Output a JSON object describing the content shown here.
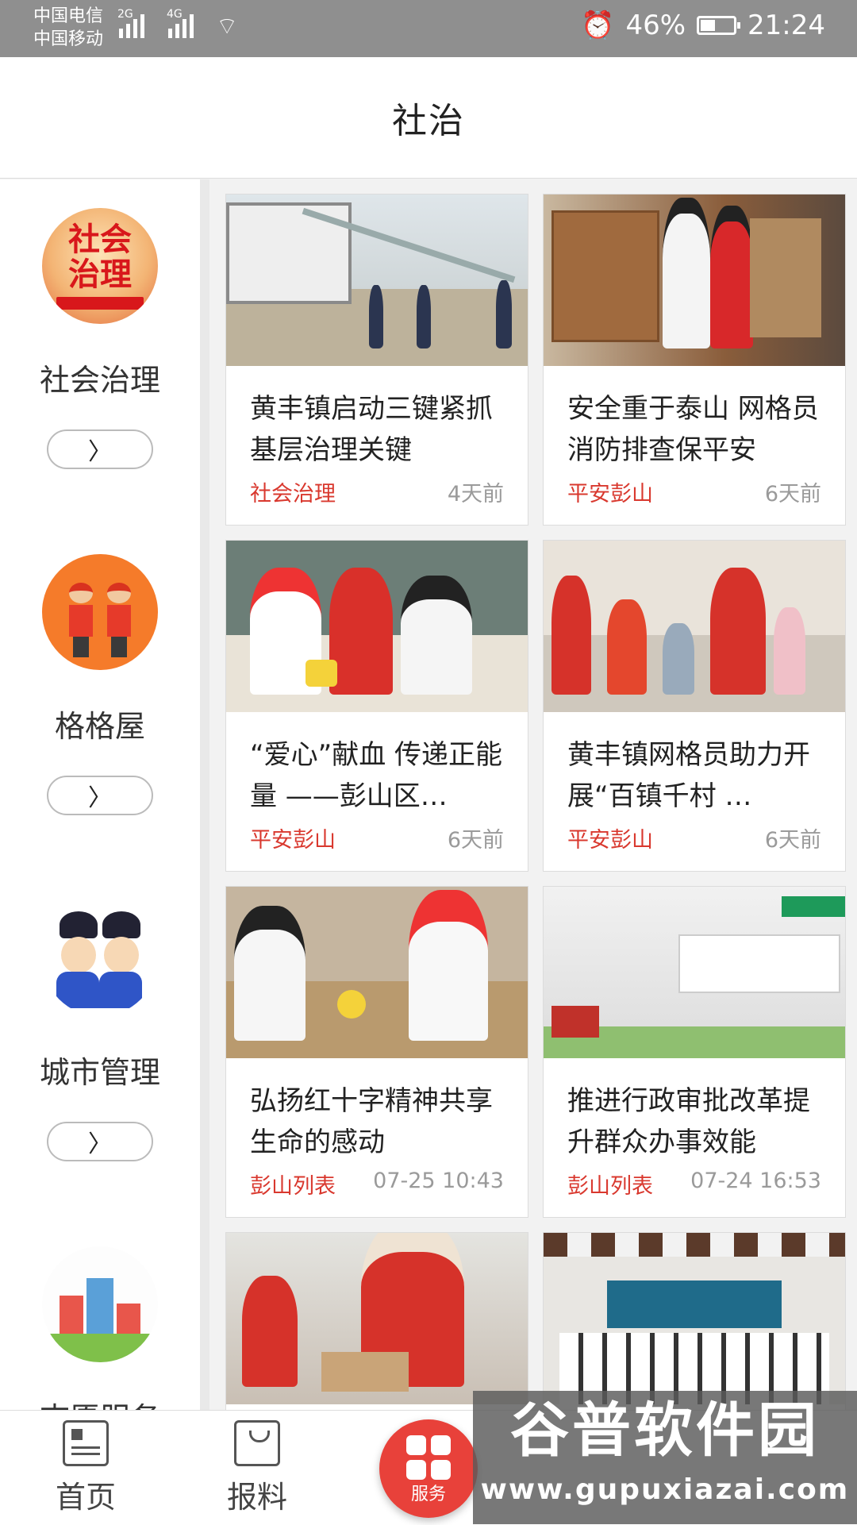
{
  "status_bar": {
    "carrier_1": "中国电信",
    "carrier_2": "中国移动",
    "net_1": "2G",
    "net_2": "4G",
    "battery": "46%",
    "battery_level": 0.46,
    "time": "21:24"
  },
  "header": {
    "title": "社治"
  },
  "sidebar": {
    "items": [
      {
        "label": "社会治理",
        "logo_text_1": "社会",
        "logo_text_2": "治理",
        "icon": "social-governance-logo"
      },
      {
        "label": "格格屋",
        "icon": "grid-workers-logo"
      },
      {
        "label": "城市管理",
        "icon": "city-management-logo"
      },
      {
        "label": "志愿服务",
        "icon": "volunteer-service-logo"
      }
    ]
  },
  "news": [
    {
      "title": "黄丰镇启动三键紧抓基层治理关键",
      "source": "社会治理",
      "time": "4天前"
    },
    {
      "title": "安全重于泰山 网格员消防排查保平安",
      "source": "平安彭山",
      "time": "6天前"
    },
    {
      "title": "“爱心”献血  传递正能量 ——彭山区…",
      "source": "平安彭山",
      "time": "6天前"
    },
    {
      "title": "黄丰镇网格员助力开展“百镇千村 …",
      "source": "平安彭山",
      "time": "6天前"
    },
    {
      "title": "弘扬红十字精神共享生命的感动",
      "source": "彭山列表",
      "time": "07-25 10:43"
    },
    {
      "title": "推进行政审批改革提升群众办事效能",
      "source": "彭山列表",
      "time": "07-24 16:53"
    },
    {
      "title": "",
      "source": "",
      "time": ""
    },
    {
      "title": "",
      "source": "",
      "time": ""
    }
  ],
  "tabbar": {
    "home": "首页",
    "report": "报料",
    "service": "服务"
  },
  "watermark": {
    "name": "谷普软件园",
    "url": "www.gupuxiazai.com"
  },
  "colors": {
    "accent": "#e8413a",
    "source_text": "#d9382e",
    "status_bar": "#8f8f8f"
  }
}
